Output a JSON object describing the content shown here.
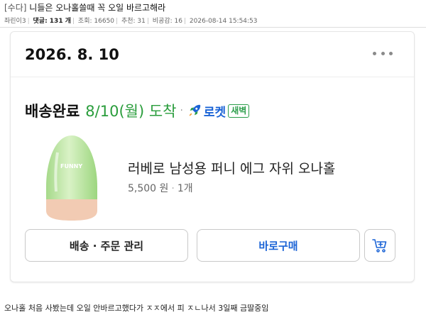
{
  "post": {
    "category": "[수다]",
    "title": "니들은 오나홀쓸때 꼭 오일 바르고해라",
    "author": "좌린이3",
    "comments_label": "댓글",
    "comments_count": "131 개",
    "views_label": "조회",
    "views": "16650",
    "recommend_label": "추천",
    "recommend": "31",
    "sympathy_label": "비공감",
    "sympathy": "16",
    "timestamp": "2026-08-14 15:54:53"
  },
  "order": {
    "date": "2026. 8. 10",
    "status": "배송완료",
    "arrival": "8/10(월) 도착",
    "rocket_label": "로켓",
    "dawn_badge": "새벽",
    "product_name": "러베로 남성용 퍼니 에그 자위 오나홀",
    "price": "5,500 원",
    "quantity": "1개",
    "product_image_text": "FUNNY",
    "buttons": {
      "manage": "배송 · 주문 관리",
      "buy_again": "바로구매"
    },
    "colors": {
      "arrival_green": "#2a9d3c",
      "rocket_blue": "#1a63d6",
      "dawn_green": "#2b9d4a"
    },
    "icons": [
      "more-icon",
      "rocket-icon",
      "add-to-cart-icon"
    ]
  },
  "comment": "오나홀 처음 사봤는데 오일 안바르고했다가 ㅈㅈ에서 피 ㅈㄴ나서 3일째 금딸중임"
}
